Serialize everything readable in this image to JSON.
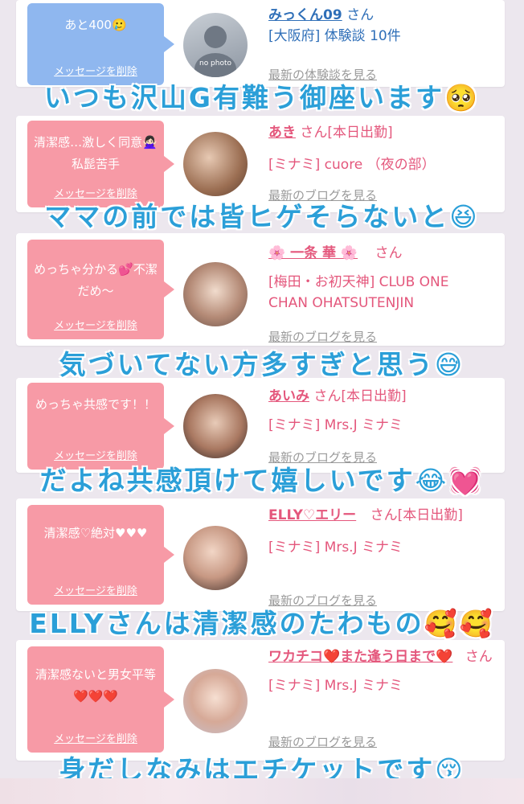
{
  "cards": [
    {
      "message": "あと400🥲",
      "delete_label": "メッセージを削除",
      "name": "みっくん09",
      "honorific": "さん",
      "shop_line1": "[大阪府] 体験談 10件",
      "shop_line2": "",
      "link": "最新の体験談を見る",
      "avatar_caption": "no photo",
      "theme": "blue"
    },
    {
      "message": "清潔感…激しく同意🙅🏻‍♀️私髭苦手",
      "delete_label": "メッセージを削除",
      "name": "あき",
      "honorific": "さん[本日出勤]",
      "shop_line1": "[ミナミ] cuore （夜の部）",
      "shop_line2": "",
      "link": "最新のブログを見る",
      "theme": "pink"
    },
    {
      "message": "めっちゃ分かる💕不潔だめ〜",
      "delete_label": "メッセージを削除",
      "name": "🌸 一条 華 🌸",
      "honorific": "さん",
      "shop_line1": "[梅田・お初天神] CLUB ONE",
      "shop_line2": "CHAN OHATSUTENJIN",
      "link": "最新のブログを見る",
      "theme": "pink"
    },
    {
      "message": "めっちゃ共感です！！",
      "delete_label": "メッセージを削除",
      "name": "あいみ",
      "honorific": "さん[本日出勤]",
      "shop_line1": "[ミナミ] Mrs.J ミナミ",
      "shop_line2": "",
      "link": "最新のブログを見る",
      "theme": "pink"
    },
    {
      "message": "清潔感♡絶対♥♥♥",
      "delete_label": "メッセージを削除",
      "name": "ELLY♡エリー",
      "honorific": "さん[本日出勤]",
      "shop_line1": "[ミナミ] Mrs.J ミナミ",
      "shop_line2": "",
      "link": "最新のブログを見る",
      "theme": "pink"
    },
    {
      "message": "清潔感ないと男女平等❤️❤️❤️",
      "delete_label": "メッセージを削除",
      "name": "ワカチコ❤️また逢う日まで❤️",
      "honorific": "さん",
      "shop_line1": "[ミナミ] Mrs.J ミナミ",
      "shop_line2": "",
      "link": "最新のブログを見る",
      "theme": "pink"
    }
  ],
  "overlay_captions": [
    "いつも沢山G有難う御座います🥺",
    "ママの前では皆ヒゲそらないと😆",
    "気づいてない方多すぎと思う😅",
    "だよね共感頂けて嬉しいです😂💓",
    "ELLYさんは清潔感のたわもの🥰🥰",
    "身だしなみはエチケットです😚"
  ],
  "colors": {
    "blue_bubble": "#8fb7ef",
    "pink_bubble": "#f79aa6",
    "name_pink": "#e4577c",
    "name_blue": "#2f6fb8",
    "caption": "#2b9fd8",
    "link_gray": "#9a9a9a"
  }
}
